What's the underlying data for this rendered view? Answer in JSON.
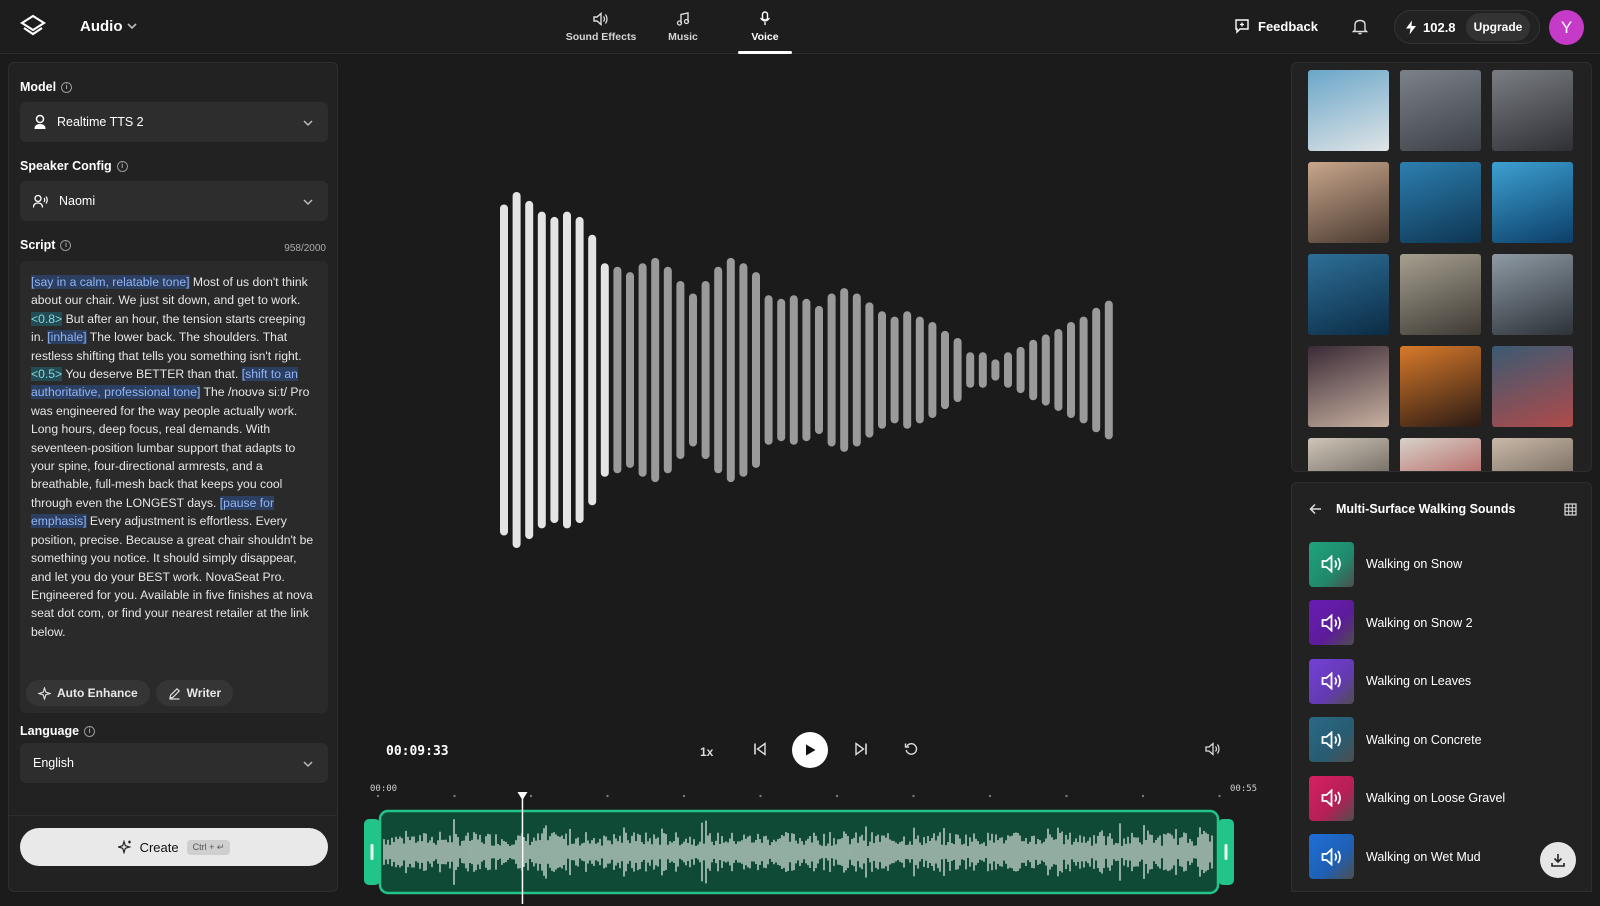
{
  "header": {
    "app_title": "Audio",
    "tabs": [
      {
        "label": "Sound Effects",
        "icon": "speaker-icon"
      },
      {
        "label": "Music",
        "icon": "music-note-icon"
      },
      {
        "label": "Voice",
        "icon": "microphone-icon",
        "active": true
      }
    ],
    "feedback_label": "Feedback",
    "credits": "102.8",
    "upgrade_label": "Upgrade",
    "avatar_initial": "Y"
  },
  "left": {
    "model_label": "Model",
    "model_value": "Realtime TTS 2",
    "speaker_label": "Speaker Config",
    "speaker_value": "Naomi",
    "script_label": "Script",
    "char_count": "958/2000",
    "script_segments": [
      {
        "text": "[say in a calm, relatable tone]",
        "kind": "tag"
      },
      {
        "text": " Most of us don't think about our chair. We just sit down, and get to work. ",
        "kind": "text"
      },
      {
        "text": "<0.8>",
        "kind": "pause"
      },
      {
        "text": " But after an hour, the tension starts creeping in. ",
        "kind": "text"
      },
      {
        "text": "[inhale]",
        "kind": "tag"
      },
      {
        "text": " The lower back. The shoulders. That restless shifting that tells you something isn't right. ",
        "kind": "text"
      },
      {
        "text": "<0.5>",
        "kind": "pause"
      },
      {
        "text": " You deserve BETTER than that. ",
        "kind": "text"
      },
      {
        "text": "[shift to an authoritative, professional tone]",
        "kind": "tag"
      },
      {
        "text": " The /noʊvə siːt/ Pro was engineered for the way people actually work. Long hours, deep focus, real demands. With seventeen-position lumbar support that adapts to your spine, four-directional armrests, and a breathable, full-mesh back that keeps you cool through even the LONGEST days. ",
        "kind": "text"
      },
      {
        "text": "[pause for emphasis]",
        "kind": "tag"
      },
      {
        "text": " Every adjustment is effortless. Every position, precise. Because a great chair shouldn't be something you notice. It should simply disappear, and let you do your BEST work. NovaSeat Pro. Engineered for you. Available in five finishes at nova seat dot com, or find your nearest retailer at the link below.",
        "kind": "text"
      }
    ],
    "auto_enhance_label": "Auto Enhance",
    "writer_label": "Writer",
    "language_label": "Language",
    "language_value": "English",
    "create_label": "Create",
    "create_shortcut": "Ctrl + ↵"
  },
  "player": {
    "current_time": "00:09:33",
    "speed": "1x",
    "start_time": "00:00",
    "end_time": "00:55",
    "progress": 0.17,
    "waveform_levels": [
      0.93,
      1.0,
      0.95,
      0.89,
      0.86,
      0.89,
      0.86,
      0.76,
      0.6,
      0.58,
      0.55,
      0.6,
      0.63,
      0.58,
      0.5,
      0.43,
      0.5,
      0.58,
      0.63,
      0.6,
      0.55,
      0.42,
      0.4,
      0.42,
      0.4,
      0.36,
      0.43,
      0.46,
      0.43,
      0.38,
      0.33,
      0.3,
      0.33,
      0.3,
      0.27,
      0.22,
      0.18,
      0.1,
      0.1,
      0.06,
      0.1,
      0.13,
      0.17,
      0.2,
      0.23,
      0.27,
      0.3,
      0.35,
      0.39
    ]
  },
  "gallery": {
    "thumb_colors": [
      [
        "#6aa6c9",
        "#dfe4e6"
      ],
      [
        "#7c828a",
        "#3c4046"
      ],
      [
        "#7a7d82",
        "#2e3036"
      ],
      [
        "#c8a68c",
        "#4a3a30"
      ],
      [
        "#2c7fb0",
        "#0e3552"
      ],
      [
        "#3ca0d2",
        "#0c3e68"
      ],
      [
        "#2e6f98",
        "#0b2c45"
      ],
      [
        "#a6a090",
        "#3e3a34"
      ],
      [
        "#8e9aa4",
        "#2c3238"
      ],
      [
        "#3a2a36",
        "#c8b0a0"
      ],
      [
        "#d87a2a",
        "#2a1a14"
      ],
      [
        "#3a5a72",
        "#b04a4a"
      ],
      [
        "#cfc5b8",
        "#3a3530"
      ],
      [
        "#d7d2ca",
        "#a62a2a"
      ],
      [
        "#c9b9a8",
        "#4a4038"
      ]
    ]
  },
  "collection": {
    "title": "Multi-Surface Walking Sounds",
    "items": [
      {
        "label": "Walking on Snow",
        "color": "#1fa37e"
      },
      {
        "label": "Walking on Snow 2",
        "color": "#6a1bb6"
      },
      {
        "label": "Walking on Leaves",
        "color": "#7440d6"
      },
      {
        "label": "Walking on Concrete",
        "color": "#2a6a86"
      },
      {
        "label": "Walking on Loose Gravel",
        "color": "#d81f63"
      },
      {
        "label": "Walking on Wet Mud",
        "color": "#1e6fd8"
      }
    ]
  }
}
